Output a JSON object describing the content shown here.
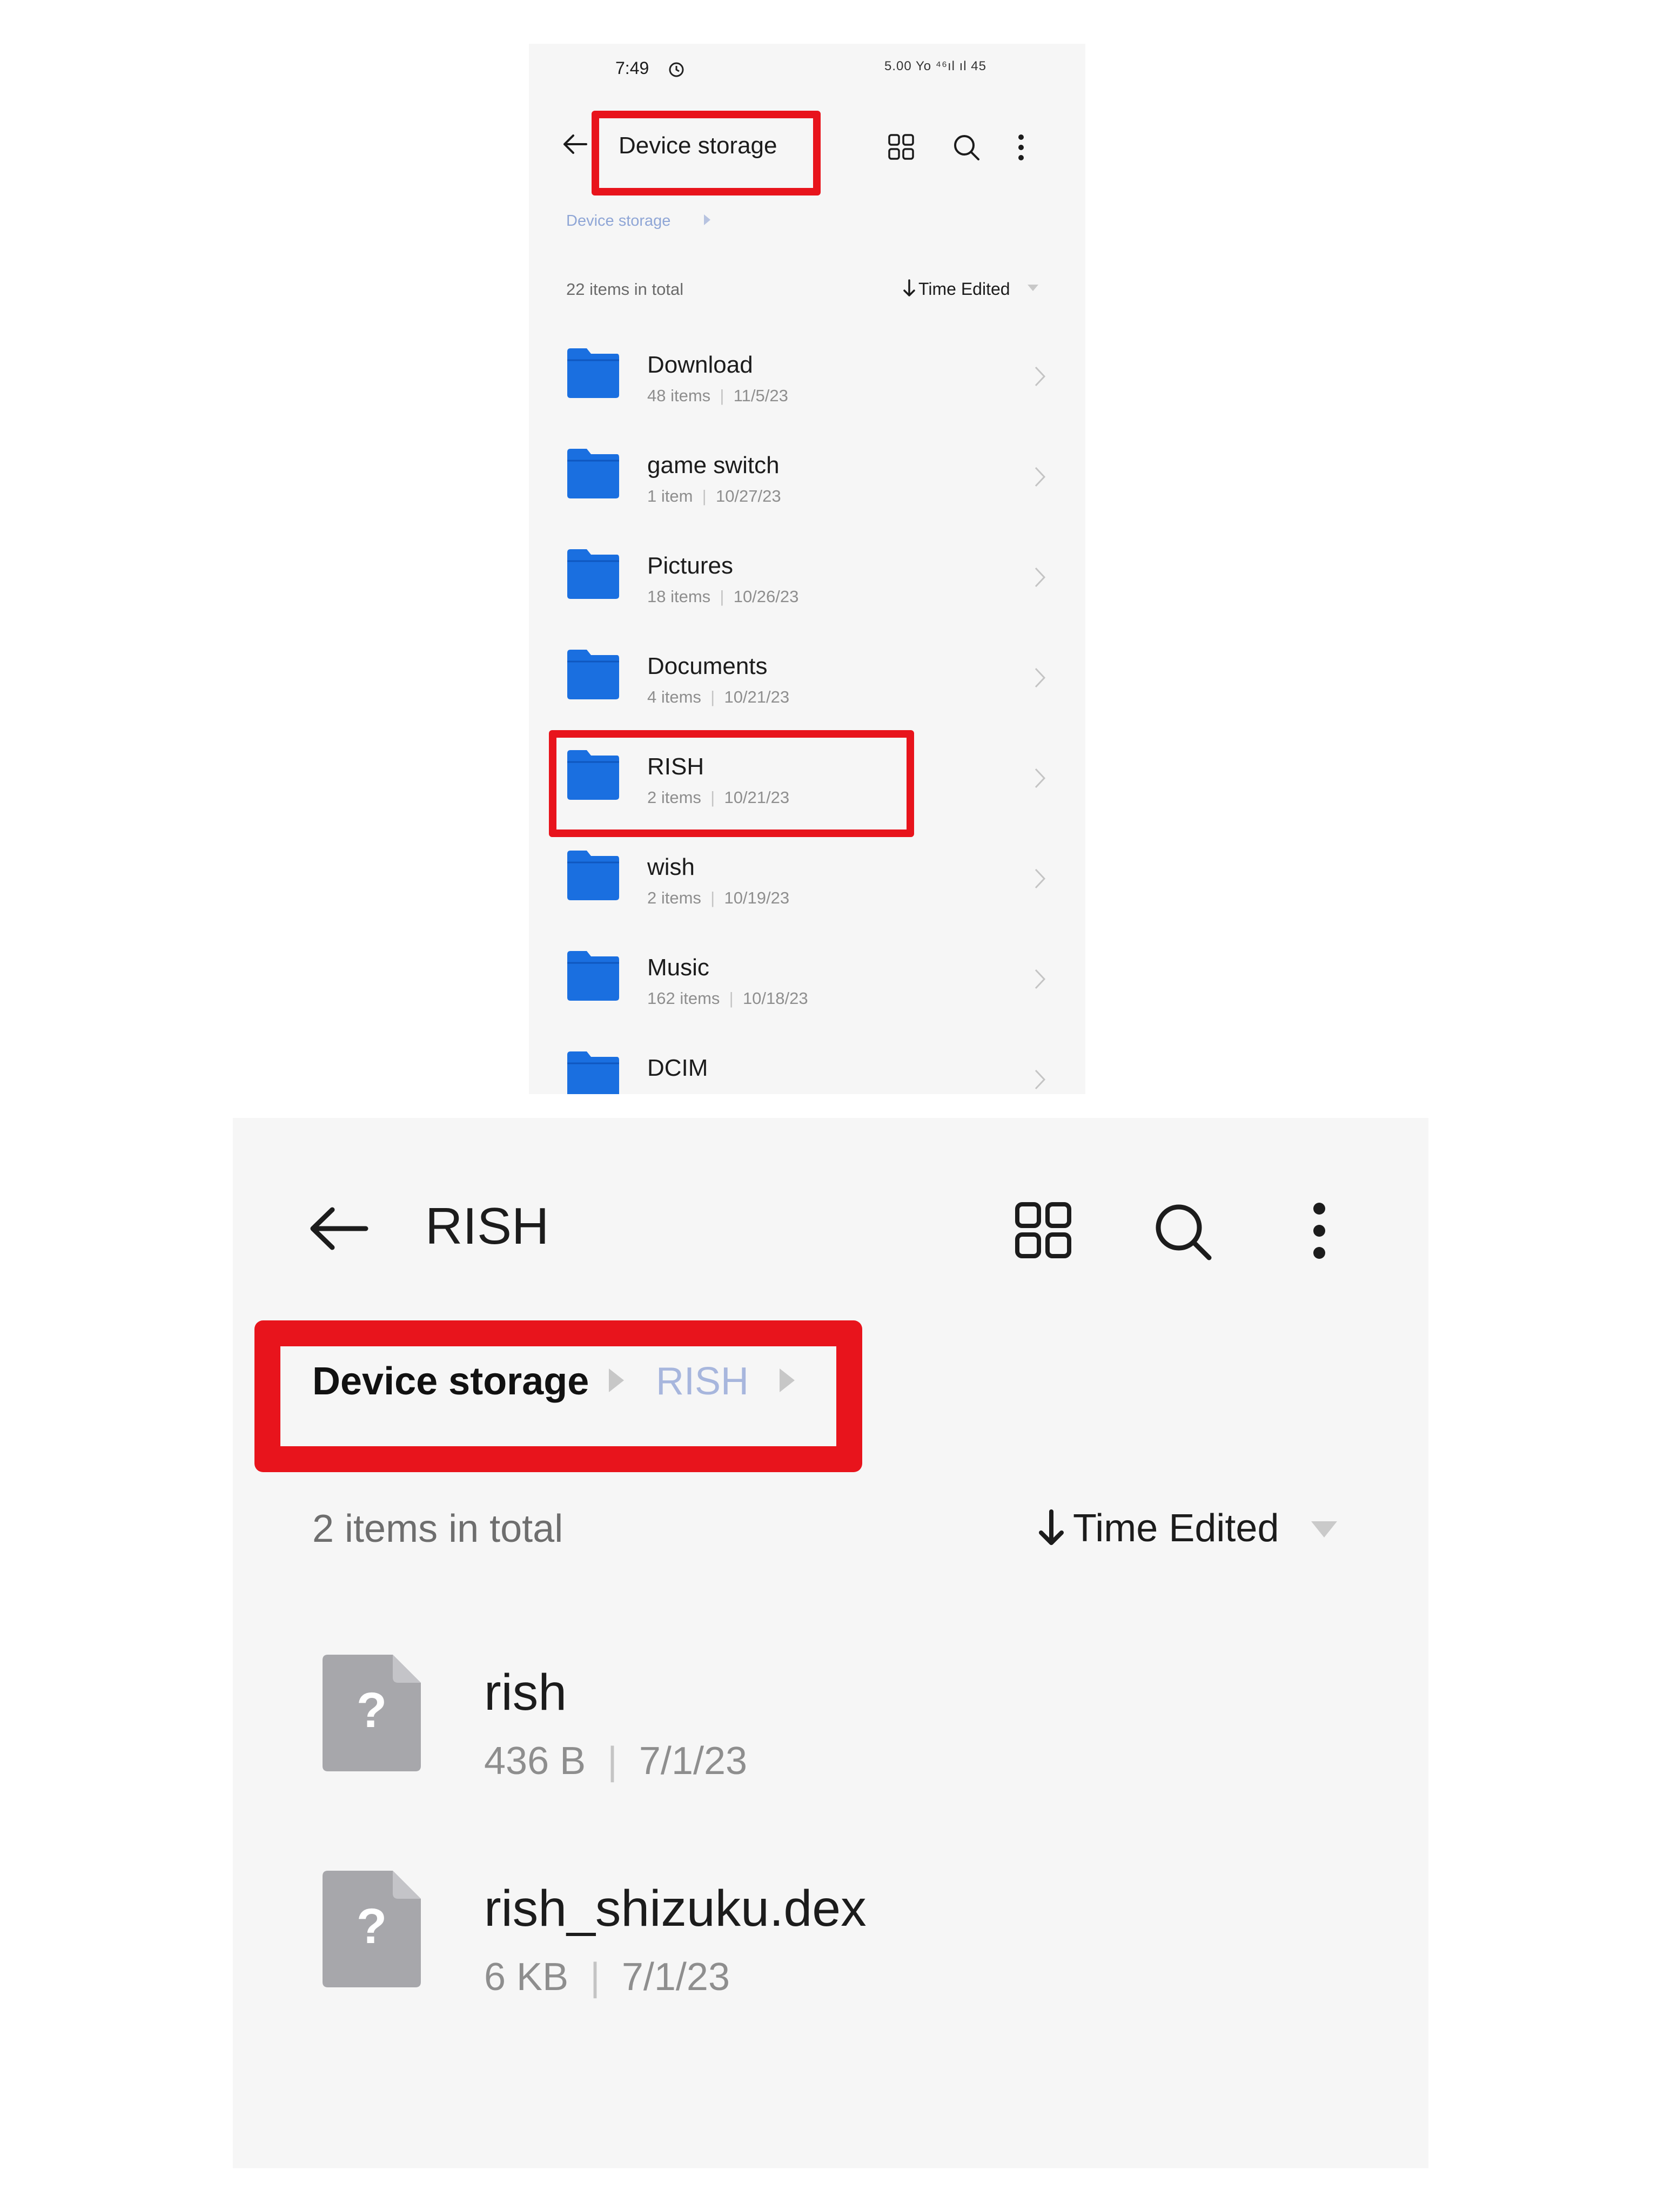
{
  "panel1": {
    "status": {
      "time": "7:49",
      "icons": "5.00 Yo ⁴⁶ıl ıl 45"
    },
    "header": {
      "title": "Device storage"
    },
    "breadcrumb": {
      "label": "Device storage"
    },
    "list_header": {
      "count": "22 items in total",
      "sort": "Time Edited"
    },
    "folders": [
      {
        "name": "Download",
        "count": "48 items",
        "date": "11/5/23"
      },
      {
        "name": "game switch",
        "count": "1 item",
        "date": "10/27/23"
      },
      {
        "name": "Pictures",
        "count": "18 items",
        "date": "10/26/23"
      },
      {
        "name": "Documents",
        "count": "4 items",
        "date": "10/21/23"
      },
      {
        "name": "RISH",
        "count": "2 items",
        "date": "10/21/23"
      },
      {
        "name": "wish",
        "count": "2 items",
        "date": "10/19/23"
      },
      {
        "name": "Music",
        "count": "162 items",
        "date": "10/18/23"
      },
      {
        "name": "DCIM",
        "count": "",
        "date": ""
      }
    ],
    "separator": "|"
  },
  "panel2": {
    "header": {
      "title": "RISH"
    },
    "breadcrumb": {
      "root": "Device storage",
      "current": "RISH"
    },
    "list_header": {
      "count": "2 items in total",
      "sort": "Time Edited"
    },
    "files": [
      {
        "name": "rish",
        "size": "436 B",
        "date": "7/1/23",
        "icon_glyph": "?"
      },
      {
        "name": "rish_shizuku.dex",
        "size": "6 KB",
        "date": "7/1/23",
        "icon_glyph": "?"
      }
    ],
    "separator": "|"
  },
  "colors": {
    "highlight": "#e8141c",
    "folder": "#1a6fe0",
    "file_icon": "#a7a7ab",
    "breadcrumb_inactive": "#a7b6dd"
  }
}
